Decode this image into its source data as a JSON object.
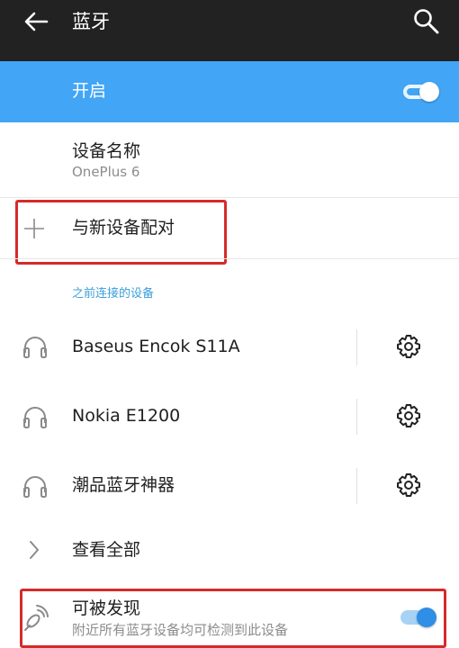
{
  "header": {
    "title": "蓝牙",
    "back_icon": "arrow-back-icon",
    "search_icon": "search-icon"
  },
  "bluetooth_toggle": {
    "label": "开启",
    "on": true
  },
  "device_name": {
    "label": "设备名称",
    "value": "OnePlus 6"
  },
  "pair_new": {
    "label": "与新设备配对",
    "icon": "plus-icon"
  },
  "previous_devices": {
    "header": "之前连接的设备",
    "items": [
      {
        "name": "Baseus Encok S11A",
        "icon": "headphones-icon",
        "settings_icon": "gear-icon"
      },
      {
        "name": "Nokia E1200",
        "icon": "headphones-icon",
        "settings_icon": "gear-icon"
      },
      {
        "name": "潮品蓝牙神器",
        "icon": "headphones-icon",
        "settings_icon": "gear-icon"
      }
    ],
    "see_all": {
      "label": "查看全部",
      "icon": "chevron-right-icon"
    }
  },
  "discoverable": {
    "label": "可被发现",
    "description": "附近所有蓝牙设备均可检测到此设备",
    "on": true,
    "icon": "bluetooth-searching-icon"
  },
  "colors": {
    "header_bg": "#222222",
    "accent": "#42a5f5",
    "section_header": "#3b9fd9",
    "highlight_border": "#d62a2a"
  }
}
